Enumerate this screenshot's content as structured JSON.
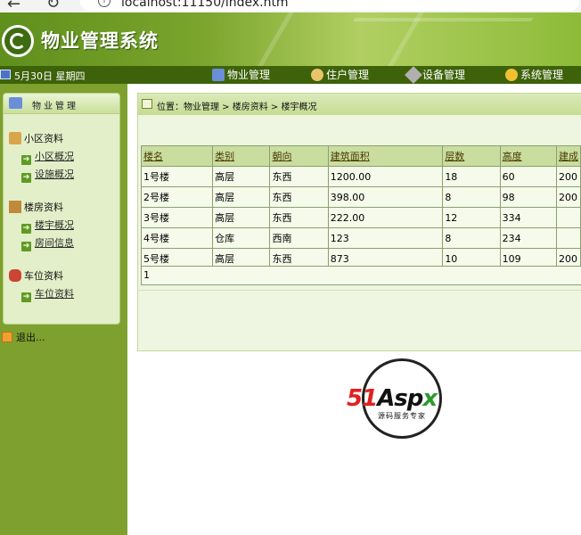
{
  "browser": {
    "url": "localhost:11150/index.htm",
    "back_glyph": "←",
    "reload_glyph": "↻",
    "info_glyph": "i"
  },
  "header": {
    "title": "物业管理系统",
    "date": "5月30日 星期四"
  },
  "menu": [
    {
      "label": "物业管理",
      "icon": "house-icon"
    },
    {
      "label": "住户管理",
      "icon": "person-icon"
    },
    {
      "label": "设备管理",
      "icon": "tool-icon"
    },
    {
      "label": "系统管理",
      "icon": "coins-icon"
    }
  ],
  "sidebar": {
    "title": "物业管理",
    "groups": [
      {
        "label": "小区资料",
        "icon": "building-icon",
        "links": [
          "小区概况",
          "设施概况"
        ]
      },
      {
        "label": "楼房资料",
        "icon": "document-icon",
        "links": [
          "楼宇概况",
          "房间信息"
        ]
      },
      {
        "label": "车位资料",
        "icon": "car-icon",
        "links": [
          "车位资料"
        ]
      }
    ],
    "exit_label": "退出..."
  },
  "breadcrumb": "位置：物业管理 > 楼房资料 > 楼宇概况",
  "table": {
    "headers": [
      "楼名",
      "类别",
      "朝向",
      "建筑面积",
      "层数",
      "高度",
      "建成"
    ],
    "rows": [
      [
        "1号楼",
        "高层",
        "东西",
        "1200.00",
        "18",
        "60",
        "200"
      ],
      [
        "2号楼",
        "高层",
        "东西",
        "398.00",
        "8",
        "98",
        "200"
      ],
      [
        "3号楼",
        "高层",
        "东西",
        "222.00",
        "12",
        "334",
        ""
      ],
      [
        "4号楼",
        "仓库",
        "西南",
        "123",
        "8",
        "234",
        ""
      ],
      [
        "5号楼",
        "高层",
        "东西",
        "873",
        "10",
        "109",
        "200"
      ]
    ],
    "pager": "1"
  },
  "watermark": {
    "num": "51",
    "mid": "Asp",
    "end": "x",
    "tagline": "源码服务专家"
  },
  "colors": {
    "header_green": "#8cb43c",
    "menubar": "#3d6209",
    "sidebar": "#7ea02e",
    "panel": "#e3efc8"
  }
}
